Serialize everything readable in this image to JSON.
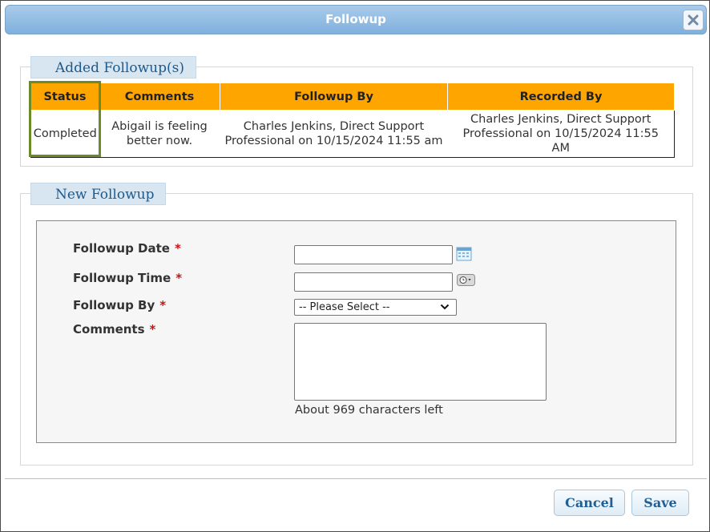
{
  "dialog": {
    "title": "Followup",
    "close_icon": "close-icon"
  },
  "added_section": {
    "legend": "Added Followup(s)",
    "columns": [
      "Status",
      "Comments",
      "Followup By",
      "Recorded By"
    ],
    "rows": [
      {
        "status": "Completed",
        "comments": "Abigail is feeling better now.",
        "followup_by": "Charles Jenkins, Direct Support Professional on 10/15/2024 11:55 am",
        "recorded_by": "Charles Jenkins, Direct Support Professional on 10/15/2024 11:55 AM"
      }
    ]
  },
  "new_section": {
    "legend": "New Followup",
    "required_mark": "*",
    "date_label": "Followup Date",
    "date_value": "",
    "time_label": "Followup Time",
    "time_value": "",
    "by_label": "Followup By",
    "by_selected": "-- Please Select --",
    "comments_label": "Comments",
    "comments_value": "",
    "chars_left": "About 969 characters left"
  },
  "footer": {
    "cancel_label": "Cancel",
    "save_label": "Save"
  },
  "colors": {
    "header_orange": "#ffa500",
    "highlight_green": "#6b8a2a",
    "title_blue": "#8db9e2"
  }
}
